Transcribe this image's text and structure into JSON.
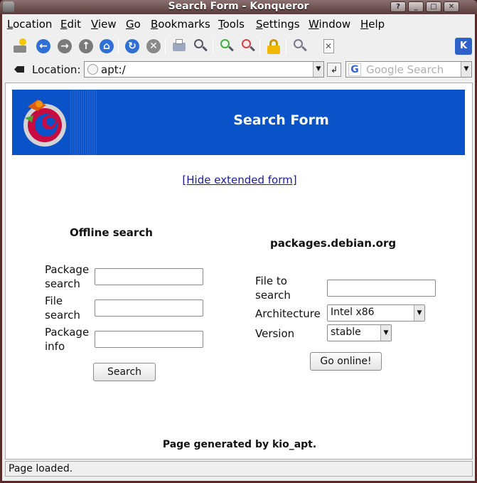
{
  "window": {
    "title": "Search Form - Konqueror"
  },
  "menubar": [
    "Location",
    "Edit",
    "View",
    "Go",
    "Bookmarks",
    "Tools",
    "Settings",
    "Window",
    "Help"
  ],
  "location": {
    "label": "Location:",
    "value": "apt:/",
    "search_placeholder": "Google Search"
  },
  "banner": {
    "title": "Search Form"
  },
  "hide_link": "[Hide extended form]",
  "offline": {
    "heading": "Offline search",
    "fields": [
      {
        "label_line1": "Package",
        "label_line2": "search"
      },
      {
        "label_line1": "File",
        "label_line2": "search"
      },
      {
        "label_line1": "Package",
        "label_line2": "info"
      }
    ],
    "button": "Search"
  },
  "online": {
    "heading": "packages.debian.org",
    "file_label_line1": "File to",
    "file_label_line2": "search",
    "arch_label": "Architecture",
    "arch_value": "Intel x86",
    "version_label": "Version",
    "version_value": "stable",
    "button": "Go online!"
  },
  "footer": "Page generated by kio_apt.",
  "status": "Page loaded."
}
